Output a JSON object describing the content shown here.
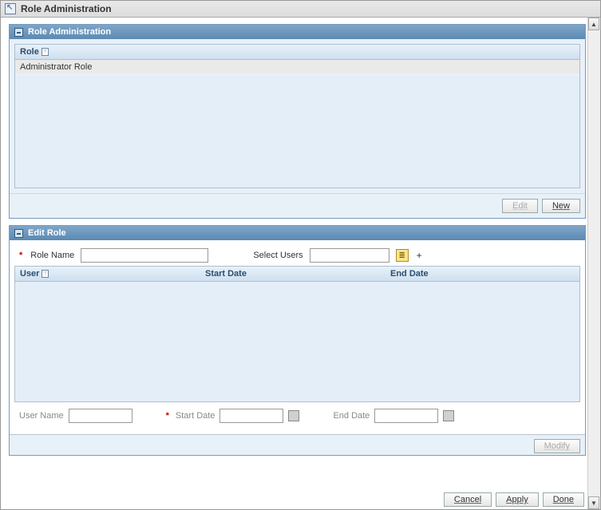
{
  "window": {
    "title": "Role Administration"
  },
  "rolePanel": {
    "title": "Role Administration",
    "columns": {
      "role": "Role"
    },
    "rows": [
      "Administrator Role"
    ],
    "buttons": {
      "edit": "Edit",
      "new": "New"
    }
  },
  "editPanel": {
    "title": "Edit Role",
    "roleNameLabel": "Role Name",
    "selectUsersLabel": "Select Users",
    "columns": {
      "user": "User",
      "startDate": "Start Date",
      "endDate": "End Date"
    },
    "secondary": {
      "userName": "User Name",
      "startDate": "Start Date",
      "endDate": "End Date"
    },
    "buttons": {
      "modify": "Modify"
    }
  },
  "globalButtons": {
    "cancel": "Cancel",
    "apply": "Apply",
    "done": "Done"
  }
}
